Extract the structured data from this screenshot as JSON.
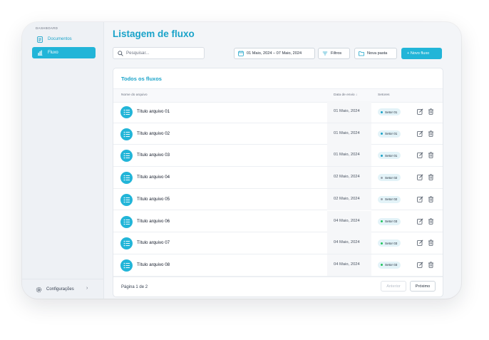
{
  "sidebar": {
    "section_label": "DASHBOARD",
    "items": [
      {
        "label": "Documentos",
        "icon": "document-icon"
      },
      {
        "label": "Fluxo",
        "icon": "bar-chart-icon"
      }
    ],
    "settings_label": "Configurações",
    "settings_icon": "gear-icon"
  },
  "header": {
    "title": "Listagem de fluxo",
    "search_placeholder": "Pesquisar...",
    "date_range": "01 Maio, 2024 – 07 Maio, 2024",
    "filters_label": "Filtros",
    "new_folder_label": "Nova pasta",
    "new_flow_label": "+ Novo fluxo"
  },
  "table": {
    "title": "Todos os fluxos",
    "columns": {
      "name": "Nome do arquivo",
      "date": "Data de envio ↓",
      "sectors": "Setores"
    },
    "rows": [
      {
        "name": "Título arquivo 01",
        "date": "01 Maio, 2024",
        "sector": "Setor 01",
        "dot_color": "#1aa3c9"
      },
      {
        "name": "Título arquivo 02",
        "date": "01 Maio, 2024",
        "sector": "Setor 01",
        "dot_color": "#1aa3c9"
      },
      {
        "name": "Título arquivo 03",
        "date": "01 Maio, 2024",
        "sector": "Setor 01",
        "dot_color": "#1aa3c9"
      },
      {
        "name": "Título arquivo 04",
        "date": "02 Maio, 2024",
        "sector": "Setor 02",
        "dot_color": "#9aa3ad"
      },
      {
        "name": "Título arquivo 05",
        "date": "02 Maio, 2024",
        "sector": "Setor 02",
        "dot_color": "#9aa3ad"
      },
      {
        "name": "Título arquivo 06",
        "date": "04 Maio, 2024",
        "sector": "Setor 03",
        "dot_color": "#22c55e"
      },
      {
        "name": "Título arquivo 07",
        "date": "04 Maio, 2024",
        "sector": "Setor 03",
        "dot_color": "#22c55e"
      },
      {
        "name": "Título arquivo 08",
        "date": "04 Maio, 2024",
        "sector": "Setor 03",
        "dot_color": "#22c55e"
      }
    ]
  },
  "pagination": {
    "info": "Página 1 de 2",
    "prev_label": "Anterior",
    "next_label": "Próximo"
  },
  "colors": {
    "accent": "#22b5d8",
    "accent_text": "#1aa3c9"
  }
}
